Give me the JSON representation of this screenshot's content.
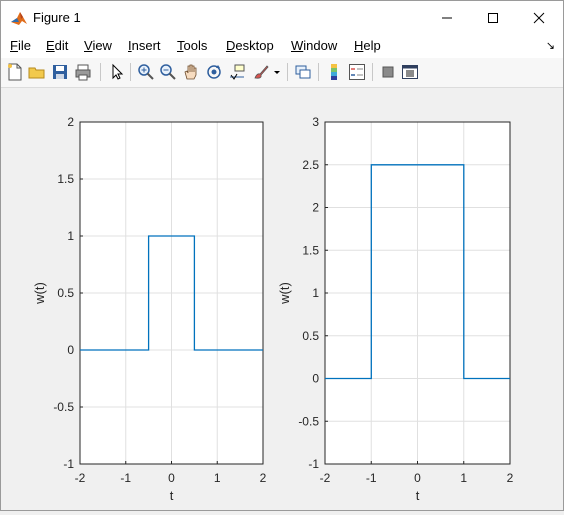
{
  "window": {
    "title": "Figure 1",
    "controls": [
      "minimize",
      "maximize",
      "close"
    ]
  },
  "menu": {
    "items": [
      {
        "label": "File",
        "mnemonic": "F"
      },
      {
        "label": "Edit",
        "mnemonic": "E"
      },
      {
        "label": "View",
        "mnemonic": "V"
      },
      {
        "label": "Insert",
        "mnemonic": "I"
      },
      {
        "label": "Tools",
        "mnemonic": "T"
      },
      {
        "label": "Desktop",
        "mnemonic": "D"
      },
      {
        "label": "Window",
        "mnemonic": "W"
      },
      {
        "label": "Help",
        "mnemonic": "H"
      }
    ]
  },
  "toolbar": {
    "tools": [
      "new-figure-icon",
      "open-file-icon",
      "save-icon",
      "print-icon",
      "pointer-icon",
      "zoom-in-icon",
      "zoom-out-icon",
      "pan-icon",
      "rotate-3d-icon",
      "data-cursor-icon",
      "brush-icon",
      "link-plot-icon",
      "colorbar-icon",
      "legend-icon",
      "hide-plot-tools-icon",
      "show-plot-tools-icon"
    ]
  },
  "colors": {
    "line": "#0072bd",
    "grid": "#e0e0e0",
    "axes": "#262626"
  },
  "chart_data": [
    {
      "type": "line",
      "xlabel": "t",
      "ylabel": "w(t)",
      "xlim": [
        -2,
        2
      ],
      "ylim": [
        -1,
        2
      ],
      "xticks": [
        "-2",
        "-1",
        "0",
        "1",
        "2"
      ],
      "yticks": [
        "-1",
        "-0.5",
        "0",
        "0.5",
        "1",
        "1.5",
        "2"
      ],
      "grid": true,
      "x": [
        -2,
        -0.5,
        -0.5,
        0.5,
        0.5,
        2
      ],
      "y": [
        0,
        0,
        1,
        1,
        0,
        0
      ]
    },
    {
      "type": "line",
      "xlabel": "t",
      "ylabel": "w(t)",
      "xlim": [
        -2,
        2
      ],
      "ylim": [
        -1,
        3
      ],
      "xticks": [
        "-2",
        "-1",
        "0",
        "1",
        "2"
      ],
      "yticks": [
        "-1",
        "-0.5",
        "0",
        "0.5",
        "1",
        "1.5",
        "2",
        "2.5",
        "3"
      ],
      "grid": true,
      "x": [
        -2,
        -1,
        -1,
        1,
        1,
        2
      ],
      "y": [
        0,
        0,
        2.5,
        2.5,
        0,
        0
      ]
    }
  ]
}
